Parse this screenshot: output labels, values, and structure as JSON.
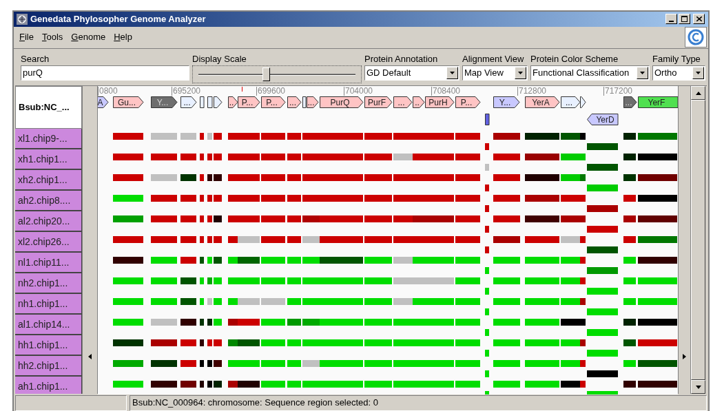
{
  "window": {
    "title": "Genedata Phylosopher Genome Analyzer"
  },
  "menu": [
    {
      "label": "File"
    },
    {
      "label": "Tools"
    },
    {
      "label": "Genome"
    },
    {
      "label": "Help"
    }
  ],
  "toolbar": {
    "search": {
      "label": "Search",
      "value": "purQ"
    },
    "display_scale": {
      "label": "Display Scale",
      "level": 0.45
    },
    "dropdowns": [
      {
        "label": "Protein Annotation",
        "value": "GD Default"
      },
      {
        "label": "Alignment View",
        "value": "Map View"
      },
      {
        "label": "Protein Color Scheme",
        "value": "Functional Classification"
      },
      {
        "label": "Family Type",
        "value": "Ortho"
      }
    ]
  },
  "genome_header": "Bsub:NC_...",
  "ruler": [
    "0800",
    "695200",
    "699600",
    "704000",
    "708400",
    "712800",
    "717200"
  ],
  "genes": [
    {
      "kind": "forward",
      "label": "A",
      "color": "#c8c8ff"
    },
    {
      "kind": "forward",
      "label": "Gu...",
      "color": "#ffc4c4"
    },
    {
      "kind": "forward",
      "label": "Y...",
      "color": "#6e6e6e"
    },
    {
      "kind": "forward",
      "label": "...",
      "color": "#e8f0ff"
    },
    {
      "kind": "box",
      "color": "#e8f0ff"
    },
    {
      "kind": "box",
      "color": "#e8f0ff"
    },
    {
      "kind": "forward",
      "color": "#e8f0ff"
    },
    {
      "kind": "forward",
      "label": "..",
      "color": "#ffc4c4"
    },
    {
      "kind": "forward",
      "label": "P...",
      "color": "#ffc4c4"
    },
    {
      "kind": "forward",
      "label": "P...",
      "color": "#ffc4c4"
    },
    {
      "kind": "forward",
      "label": "...",
      "color": "#ffc4c4"
    },
    {
      "kind": "box",
      "color": "#e8f0ff"
    },
    {
      "kind": "forward",
      "label": "...",
      "color": "#ffc4c4"
    },
    {
      "kind": "forward",
      "label": "PurQ",
      "color": "#ffc4c4"
    },
    {
      "kind": "forward",
      "label": "PurF",
      "color": "#ffc4c4"
    },
    {
      "kind": "forward",
      "label": "...",
      "color": "#ffc4c4"
    },
    {
      "kind": "forward",
      "label": "..",
      "color": "#ffc4c4"
    },
    {
      "kind": "forward",
      "label": "PurH",
      "color": "#ffc4c4"
    },
    {
      "kind": "forward",
      "label": "P...",
      "color": "#ffc4c4"
    },
    {
      "kind": "box",
      "color": "#6060e0"
    },
    {
      "kind": "forward",
      "label": "Y...",
      "color": "#c8c8ff"
    },
    {
      "kind": "forward",
      "label": "YerA",
      "color": "#ffc4c4"
    },
    {
      "kind": "forward",
      "label": "...",
      "color": "#e8f0ff"
    },
    {
      "kind": "forward",
      "color": "#e8f0ff"
    },
    {
      "kind": "reverse",
      "label": "YerD",
      "color": "#c8c8ff"
    },
    {
      "kind": "forward",
      "label": "...",
      "color": "#6e6e6e"
    },
    {
      "kind": "box",
      "label": "YerF",
      "color": "#50e050"
    }
  ],
  "tracks": [
    {
      "label": "xl1.chip9-...",
      "cells": [
        {
          "color": "#cc0000"
        },
        {
          "color": "#c0c0c0"
        },
        {
          "color": "#c0c0c0"
        },
        {
          "color": "#cc0000"
        },
        {
          "color": "#c0c0c0"
        },
        {
          "color": "#cc0000"
        },
        {
          "color": "#cc0000"
        },
        {
          "color": "#cc0000"
        },
        {
          "color": "#cc0000"
        },
        {
          "color": "#cc0000"
        },
        {
          "color": "#cc0000"
        },
        {
          "color": "#cc0000"
        },
        {
          "color": "#cc0000"
        },
        {
          "color": "#cc0000"
        },
        {
          "color": "#cc0000"
        },
        {
          "color": "#cc0000"
        },
        {
          "color": "#cc0000"
        },
        {
          "color": "#cc0000"
        },
        {
          "color": "#aa0000"
        },
        {
          "color": "#002200"
        },
        {
          "color": "#005500"
        },
        {
          "color": "#000000"
        },
        {
          "color": "#005500"
        },
        {
          "color": "#002200"
        },
        {
          "color": "#007700"
        }
      ]
    },
    {
      "label": "xh1.chip1...",
      "cells": [
        {
          "color": "#cc0000"
        },
        {
          "color": "#cc0000"
        },
        {
          "color": "#cc0000"
        },
        {
          "color": "#cc0000"
        },
        {
          "color": "#cc0000"
        },
        {
          "color": "#cc0000"
        },
        {
          "color": "#cc0000"
        },
        {
          "color": "#cc0000"
        },
        {
          "color": "#cc0000"
        },
        {
          "color": "#cc0000"
        },
        {
          "color": "#cc0000"
        },
        {
          "color": "#cc0000"
        },
        {
          "color": "#cc0000"
        },
        {
          "color": "#c0c0c0"
        },
        {
          "color": "#cc0000"
        },
        {
          "color": "#cc0000"
        },
        {
          "color": "#cc0000"
        },
        {
          "color": "#c0c0c0"
        },
        {
          "color": "#cc0000"
        },
        {
          "color": "#990000"
        },
        {
          "color": "#00cc00"
        },
        {
          "color": "#00cc00"
        },
        {
          "color": "#005500"
        },
        {
          "color": "#002200"
        },
        {
          "color": "#000000"
        }
      ]
    },
    {
      "label": "xh2.chip1...",
      "cells": [
        {
          "color": "#cc0000"
        },
        {
          "color": "#c0c0c0"
        },
        {
          "color": "#003300"
        },
        {
          "color": "#cc0000"
        },
        {
          "color": "#300000"
        },
        {
          "color": "#300000"
        },
        {
          "color": "#cc0000"
        },
        {
          "color": "#cc0000"
        },
        {
          "color": "#cc0000"
        },
        {
          "color": "#cc0000"
        },
        {
          "color": "#cc0000"
        },
        {
          "color": "#cc0000"
        },
        {
          "color": "#cc0000"
        },
        {
          "color": "#cc0000"
        },
        {
          "color": "#cc0000"
        },
        {
          "color": "#cc0000"
        },
        {
          "color": "#cc0000"
        },
        {
          "color": "#cc0000"
        },
        {
          "color": "#cc0000"
        },
        {
          "color": "#200000"
        },
        {
          "color": "#00cc00"
        },
        {
          "color": "#007700"
        },
        {
          "color": "#00cc00"
        },
        {
          "color": "#003300"
        },
        {
          "color": "#700000"
        }
      ]
    },
    {
      "label": "ah2.chip8....",
      "cells": [
        {
          "color": "#00dd00"
        },
        {
          "color": "#cc0000"
        },
        {
          "color": "#cc0000"
        },
        {
          "color": "#cc0000"
        },
        {
          "color": "#cc0000"
        },
        {
          "color": "#cc0000"
        },
        {
          "color": "#cc0000"
        },
        {
          "color": "#cc0000"
        },
        {
          "color": "#cc0000"
        },
        {
          "color": "#cc0000"
        },
        {
          "color": "#cc0000"
        },
        {
          "color": "#cc0000"
        },
        {
          "color": "#cc0000"
        },
        {
          "color": "#cc0000"
        },
        {
          "color": "#cc0000"
        },
        {
          "color": "#cc0000"
        },
        {
          "color": "#cc0000"
        },
        {
          "color": "#cc0000"
        },
        {
          "color": "#cc0000"
        },
        {
          "color": "#aa0000"
        },
        {
          "color": "#cc0000"
        },
        {
          "color": "#cc0000"
        },
        {
          "color": "#aa0000"
        },
        {
          "color": "#cc0000"
        },
        {
          "color": "#000000"
        }
      ]
    },
    {
      "label": "al2.chip20...",
      "cells": [
        {
          "color": "#00a000"
        },
        {
          "color": "#cc0000"
        },
        {
          "color": "#cc0000"
        },
        {
          "color": "#cc0000"
        },
        {
          "color": "#cc0000"
        },
        {
          "color": "#200000"
        },
        {
          "color": "#cc0000"
        },
        {
          "color": "#cc0000"
        },
        {
          "color": "#cc0000"
        },
        {
          "color": "#cc0000"
        },
        {
          "color": "#b00000"
        },
        {
          "color": "#cc0000"
        },
        {
          "color": "#cc0000"
        },
        {
          "color": "#cc0000"
        },
        {
          "color": "#aa0000"
        },
        {
          "color": "#aa0000"
        },
        {
          "color": "#cc0000"
        },
        {
          "color": "#cc0000"
        },
        {
          "color": "#cc0000"
        },
        {
          "color": "#400000"
        },
        {
          "color": "#aa0000"
        },
        {
          "color": "#aa0000"
        },
        {
          "color": "#cc0000"
        },
        {
          "color": "#aa0000"
        },
        {
          "color": "#600000"
        }
      ]
    },
    {
      "label": "xl2.chip26...",
      "cells": [
        {
          "color": "#cc0000"
        },
        {
          "color": "#cc0000"
        },
        {
          "color": "#cc0000"
        },
        {
          "color": "#cc0000"
        },
        {
          "color": "#cc0000"
        },
        {
          "color": "#cc0000"
        },
        {
          "color": "#cc0000"
        },
        {
          "color": "#c0c0c0"
        },
        {
          "color": "#cc0000"
        },
        {
          "color": "#cc0000"
        },
        {
          "color": "#c0c0c0"
        },
        {
          "color": "#cc0000"
        },
        {
          "color": "#cc0000"
        },
        {
          "color": "#cc0000"
        },
        {
          "color": "#cc0000"
        },
        {
          "color": "#cc0000"
        },
        {
          "color": "#cc0000"
        },
        {
          "color": "#cc0000"
        },
        {
          "color": "#aa0000"
        },
        {
          "color": "#cc0000"
        },
        {
          "color": "#c0c0c0"
        },
        {
          "color": "#cc0000"
        },
        {
          "color": "#005500"
        },
        {
          "color": "#cc0000"
        },
        {
          "color": "#007700"
        }
      ]
    },
    {
      "label": "nl1.chip11...",
      "cells": [
        {
          "color": "#300000"
        },
        {
          "color": "#00dd00"
        },
        {
          "color": "#cc0000"
        },
        {
          "color": "#005500"
        },
        {
          "color": "#00dd00"
        },
        {
          "color": "#005500"
        },
        {
          "color": "#00dd00"
        },
        {
          "color": "#006600"
        },
        {
          "color": "#00dd00"
        },
        {
          "color": "#00dd00"
        },
        {
          "color": "#00dd00"
        },
        {
          "color": "#005500"
        },
        {
          "color": "#00dd00"
        },
        {
          "color": "#c0c0c0"
        },
        {
          "color": "#00dd00"
        },
        {
          "color": "#00dd00"
        },
        {
          "color": "#00dd00"
        },
        {
          "color": "#00dd00"
        },
        {
          "color": "#00dd00"
        },
        {
          "color": "#00dd00"
        },
        {
          "color": "#00dd00"
        },
        {
          "color": "#cc0000"
        },
        {
          "color": "#009900"
        },
        {
          "color": "#00dd00"
        },
        {
          "color": "#300000"
        }
      ]
    },
    {
      "label": "nh2.chip1...",
      "cells": [
        {
          "color": "#00dd00"
        },
        {
          "color": "#00dd00"
        },
        {
          "color": "#005500"
        },
        {
          "color": "#00dd00"
        },
        {
          "color": "#00aa00"
        },
        {
          "color": "#00dd00"
        },
        {
          "color": "#00dd00"
        },
        {
          "color": "#00dd00"
        },
        {
          "color": "#00dd00"
        },
        {
          "color": "#00dd00"
        },
        {
          "color": "#00dd00"
        },
        {
          "color": "#00dd00"
        },
        {
          "color": "#00dd00"
        },
        {
          "color": "#c0c0c0"
        },
        {
          "color": "#c0c0c0"
        },
        {
          "color": "#c0c0c0"
        },
        {
          "color": "#00dd00"
        },
        {
          "color": "#00dd00"
        },
        {
          "color": "#00dd00"
        },
        {
          "color": "#00dd00"
        },
        {
          "color": "#00dd00"
        },
        {
          "color": "#cc0000"
        },
        {
          "color": "#00dd00"
        },
        {
          "color": "#00dd00"
        },
        {
          "color": "#00dd00"
        }
      ]
    },
    {
      "label": "nh1.chip1...",
      "cells": [
        {
          "color": "#00dd00"
        },
        {
          "color": "#00dd00"
        },
        {
          "color": "#005500"
        },
        {
          "color": "#00dd00"
        },
        {
          "color": "#c0c0c0"
        },
        {
          "color": "#00dd00"
        },
        {
          "color": "#00dd00"
        },
        {
          "color": "#c0c0c0"
        },
        {
          "color": "#c0c0c0"
        },
        {
          "color": "#00dd00"
        },
        {
          "color": "#00dd00"
        },
        {
          "color": "#00dd00"
        },
        {
          "color": "#00dd00"
        },
        {
          "color": "#c0c0c0"
        },
        {
          "color": "#00dd00"
        },
        {
          "color": "#00dd00"
        },
        {
          "color": "#00dd00"
        },
        {
          "color": "#00dd00"
        },
        {
          "color": "#00dd00"
        },
        {
          "color": "#00dd00"
        },
        {
          "color": "#00dd00"
        },
        {
          "color": "#aa0000"
        },
        {
          "color": "#00dd00"
        },
        {
          "color": "#00dd00"
        },
        {
          "color": "#00dd00"
        }
      ]
    },
    {
      "label": "al1.chip14...",
      "cells": [
        {
          "color": "#00dd00"
        },
        {
          "color": "#c0c0c0"
        },
        {
          "color": "#300000"
        },
        {
          "color": "#003300"
        },
        {
          "color": "#002200"
        },
        {
          "color": "#00dd00"
        },
        {
          "color": "#aa0000"
        },
        {
          "color": "#cc0000"
        },
        {
          "color": "#00dd00"
        },
        {
          "color": "#009900"
        },
        {
          "color": "#00aa00"
        },
        {
          "color": "#00dd00"
        },
        {
          "color": "#00dd00"
        },
        {
          "color": "#00dd00"
        },
        {
          "color": "#00dd00"
        },
        {
          "color": "#00dd00"
        },
        {
          "color": "#00dd00"
        },
        {
          "color": "#00dd00"
        },
        {
          "color": "#00dd00"
        },
        {
          "color": "#00dd00"
        },
        {
          "color": "#000000"
        },
        {
          "color": "#000000"
        },
        {
          "color": "#00dd00"
        },
        {
          "color": "#002200"
        },
        {
          "color": "#000000"
        }
      ]
    },
    {
      "label": "hh1.chip1...",
      "cells": [
        {
          "color": "#003300"
        },
        {
          "color": "#aa0000"
        },
        {
          "color": "#cc0000"
        },
        {
          "color": "#300000"
        },
        {
          "color": "#cc0000"
        },
        {
          "color": "#cc0000"
        },
        {
          "color": "#008800"
        },
        {
          "color": "#005500"
        },
        {
          "color": "#00dd00"
        },
        {
          "color": "#00dd00"
        },
        {
          "color": "#00dd00"
        },
        {
          "color": "#00dd00"
        },
        {
          "color": "#00dd00"
        },
        {
          "color": "#00dd00"
        },
        {
          "color": "#00dd00"
        },
        {
          "color": "#00dd00"
        },
        {
          "color": "#00dd00"
        },
        {
          "color": "#00dd00"
        },
        {
          "color": "#00dd00"
        },
        {
          "color": "#00dd00"
        },
        {
          "color": "#00dd00"
        },
        {
          "color": "#aa0000"
        },
        {
          "color": "#00dd00"
        },
        {
          "color": "#005500"
        },
        {
          "color": "#cc0000"
        }
      ]
    },
    {
      "label": "hh2.chip1...",
      "cells": [
        {
          "color": "#00aa00"
        },
        {
          "color": "#003300"
        },
        {
          "color": "#cc0000"
        },
        {
          "color": "#000000"
        },
        {
          "color": "#000000"
        },
        {
          "color": "#400000"
        },
        {
          "color": "#00dd00"
        },
        {
          "color": "#00dd00"
        },
        {
          "color": "#00dd00"
        },
        {
          "color": "#00dd00"
        },
        {
          "color": "#c0c0c0"
        },
        {
          "color": "#00dd00"
        },
        {
          "color": "#00dd00"
        },
        {
          "color": "#00dd00"
        },
        {
          "color": "#00dd00"
        },
        {
          "color": "#00dd00"
        },
        {
          "color": "#00dd00"
        },
        {
          "color": "#00dd00"
        },
        {
          "color": "#00dd00"
        },
        {
          "color": "#00dd00"
        },
        {
          "color": "#00dd00"
        },
        {
          "color": "#cc0000"
        },
        {
          "color": "#000000"
        },
        {
          "color": "#00dd00"
        },
        {
          "color": "#005500"
        }
      ]
    },
    {
      "label": "ah1.chip1...",
      "cells": [
        {
          "color": "#00dd00"
        },
        {
          "color": "#300000"
        },
        {
          "color": "#700000"
        },
        {
          "color": "#200000"
        },
        {
          "color": "#000000"
        },
        {
          "color": "#002200"
        },
        {
          "color": "#aa0000"
        },
        {
          "color": "#200000"
        },
        {
          "color": "#00dd00"
        },
        {
          "color": "#00dd00"
        },
        {
          "color": "#00dd00"
        },
        {
          "color": "#00dd00"
        },
        {
          "color": "#00dd00"
        },
        {
          "color": "#00dd00"
        },
        {
          "color": "#00dd00"
        },
        {
          "color": "#00dd00"
        },
        {
          "color": "#00dd00"
        },
        {
          "color": "#00dd00"
        },
        {
          "color": "#00dd00"
        },
        {
          "color": "#00dd00"
        },
        {
          "color": "#000000"
        },
        {
          "color": "#cc0000"
        },
        {
          "color": "#00dd00"
        },
        {
          "color": "#300000"
        },
        {
          "color": "#300000"
        }
      ]
    }
  ],
  "status_bar": {
    "text": "Bsub:NC_000964: chromosome: Sequence region selected: 0"
  }
}
